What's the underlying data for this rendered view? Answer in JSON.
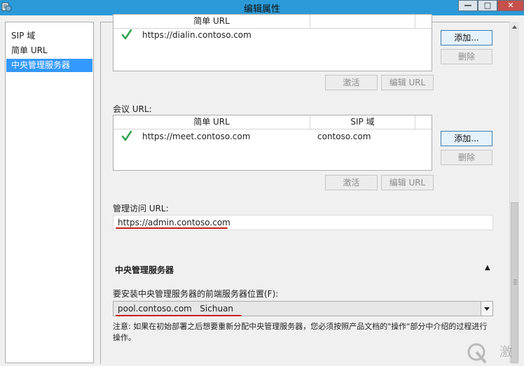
{
  "window": {
    "title": "编辑属性",
    "minimize": "—",
    "maximize": "□",
    "close": "✕"
  },
  "nav": {
    "items": [
      "SIP 域",
      "简单 URL",
      "中央管理服务器"
    ],
    "selected_index": 2
  },
  "dialin": {
    "header_simple_url": "简单 URL",
    "rows": [
      {
        "url": "https://dialin.contoso.com"
      }
    ],
    "add_label": "添加...",
    "delete_label": "删除",
    "activate_label": "激活",
    "edit_label": "编辑 URL"
  },
  "meeting": {
    "section_label": "会议 URL:",
    "header_simple_url": "简单 URL",
    "header_sip_domain": "SIP 域",
    "rows": [
      {
        "url": "https://meet.contoso.com",
        "sip": "contoso.com"
      }
    ],
    "add_label": "添加...",
    "delete_label": "删除",
    "activate_label": "激活",
    "edit_label": "编辑 URL"
  },
  "admin": {
    "label": "管理访问 URL:",
    "value": "https://admin.contoso.com"
  },
  "cms": {
    "section_title": "中央管理服务器",
    "collapse_glyph": "▲",
    "location_label": "要安装中央管理服务器的前端服务器位置(F):",
    "location_value": "pool.contoso.com   Sichuan",
    "note": "注意: 如果在初始部署之后想要重新分配中央管理服务器，您必须按照产品文档的\"操作\"部分中介绍的过程进行操作。"
  },
  "colors": {
    "titlebar": "#2b9ad8",
    "selection": "#3399ff",
    "annotation": "#c81b1b",
    "check": "#2ea44f"
  },
  "watermark_text": "激"
}
